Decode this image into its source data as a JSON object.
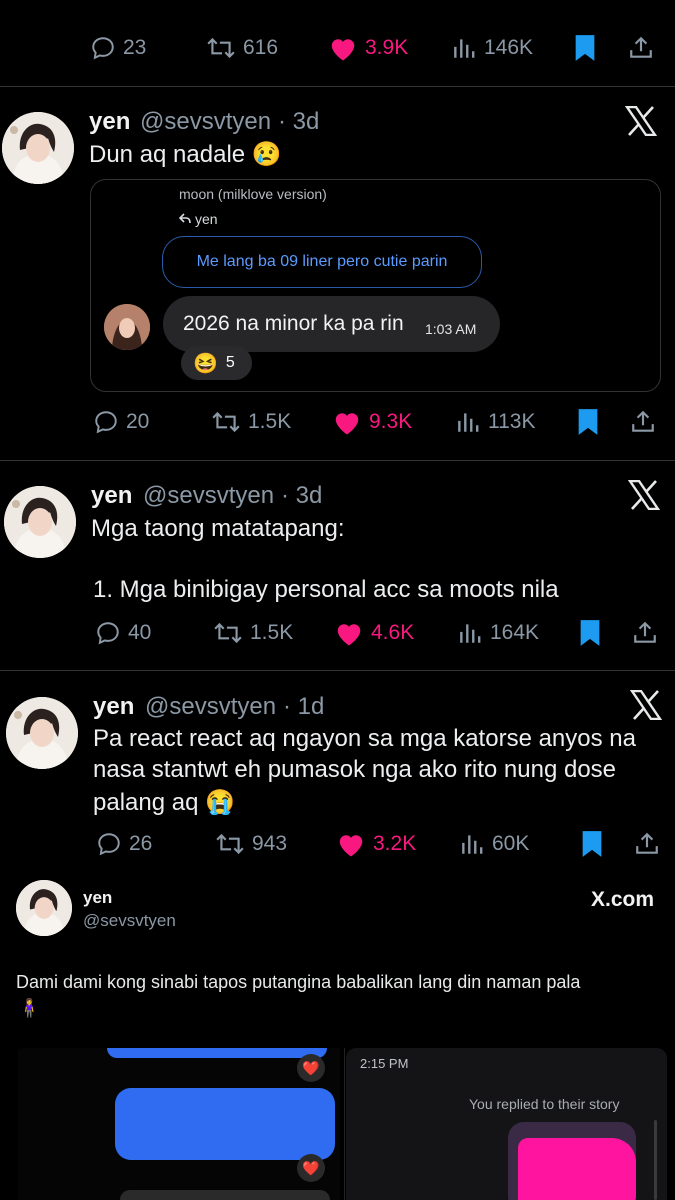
{
  "colors": {
    "like": "#f91880",
    "bookmark": "#1d9bf0",
    "muted": "#8b98a5",
    "divider": "#2f3336"
  },
  "tweets": [
    {
      "stats": {
        "replies": "23",
        "retweets": "616",
        "likes": "3.9K",
        "views": "146K"
      }
    },
    {
      "name": "yen",
      "handle": "@sevsvtyen",
      "time": "· 3d",
      "text": "Dun aq nadale 😢",
      "quote": {
        "chat_title": "moon (milklove version)",
        "reply_to": "yen",
        "replied_bubble": "Me lang ba 09 liner pero cutie parin",
        "message": "2026 na minor ka pa rin",
        "message_time": "1:03 AM",
        "reaction_emoji": "😆",
        "reaction_count": "5"
      },
      "stats": {
        "replies": "20",
        "retweets": "1.5K",
        "likes": "9.3K",
        "views": "113K"
      }
    },
    {
      "name": "yen",
      "handle": "@sevsvtyen",
      "time": "· 3d",
      "line1": "Mga taong matatapang:",
      "line2": "1. Mga binibigay personal acc sa moots nila",
      "stats": {
        "replies": "40",
        "retweets": "1.5K",
        "likes": "4.6K",
        "views": "164K"
      }
    },
    {
      "name": "yen",
      "handle": "@sevsvtyen",
      "time": "· 1d",
      "line1": "Pa react react aq ngayon sa mga katorse anyos na",
      "line2": "nasa stantwt eh pumasok nga ako rito nung dose",
      "line3": "palang aq 😭",
      "stats": {
        "replies": "26",
        "retweets": "943",
        "likes": "3.2K",
        "views": "60K"
      }
    }
  ],
  "embed": {
    "name": "yen",
    "handle": "@sevsvtyen",
    "source": "X.com",
    "text": "Dami dami kong sinabi tapos putangina babalikan lang din naman pala",
    "emoji": "🧍‍♀️",
    "screenshot": {
      "time": "2:15 PM",
      "note": "You replied to their story",
      "heart": "❤️"
    }
  }
}
